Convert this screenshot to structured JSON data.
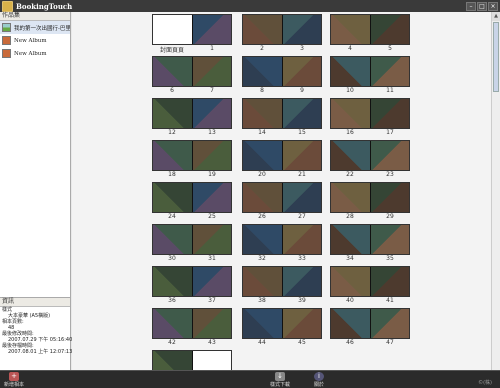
{
  "window": {
    "title": "BookingTouch"
  },
  "sidebar": {
    "label": "作品集",
    "albums": [
      {
        "label": "我的第一次出國行-巴里島",
        "icon": "photo-album-icon"
      },
      {
        "label": "New Album",
        "icon": "book-icon"
      },
      {
        "label": "New Album",
        "icon": "book-icon"
      }
    ]
  },
  "info": {
    "label": "資訊",
    "rows": [
      {
        "text": "樣式",
        "ind": false
      },
      {
        "text": "大本豪華 (A5橫版)",
        "ind": true
      },
      {
        "text": "相本頁數:",
        "ind": false
      },
      {
        "text": "48",
        "ind": true
      },
      {
        "text": "最後修改時間:",
        "ind": false
      },
      {
        "text": "2007.07.29 下午 05:16:40",
        "ind": true
      },
      {
        "text": "最後存檔時間:",
        "ind": false
      },
      {
        "text": "2007.08.01 上午 12:07:13",
        "ind": true
      }
    ]
  },
  "spreads": [
    {
      "labels": [
        "封面頁頁",
        "1"
      ],
      "left_blank": true
    },
    {
      "labels": [
        "2",
        "3"
      ]
    },
    {
      "labels": [
        "4",
        "5"
      ]
    },
    {
      "labels": [
        "6",
        "7"
      ]
    },
    {
      "labels": [
        "8",
        "9"
      ]
    },
    {
      "labels": [
        "10",
        "11"
      ]
    },
    {
      "labels": [
        "12",
        "13"
      ]
    },
    {
      "labels": [
        "14",
        "15"
      ]
    },
    {
      "labels": [
        "16",
        "17"
      ]
    },
    {
      "labels": [
        "18",
        "19"
      ]
    },
    {
      "labels": [
        "20",
        "21"
      ]
    },
    {
      "labels": [
        "22",
        "23"
      ]
    },
    {
      "labels": [
        "24",
        "25"
      ]
    },
    {
      "labels": [
        "26",
        "27"
      ]
    },
    {
      "labels": [
        "28",
        "29"
      ]
    },
    {
      "labels": [
        "30",
        "31"
      ]
    },
    {
      "labels": [
        "32",
        "33"
      ]
    },
    {
      "labels": [
        "34",
        "35"
      ]
    },
    {
      "labels": [
        "36",
        "37"
      ]
    },
    {
      "labels": [
        "38",
        "39"
      ]
    },
    {
      "labels": [
        "40",
        "41"
      ]
    },
    {
      "labels": [
        "42",
        "43"
      ]
    },
    {
      "labels": [
        "44",
        "45"
      ]
    },
    {
      "labels": [
        "46",
        "47"
      ]
    },
    {
      "labels": [
        "",
        ""
      ],
      "right_blank": true
    }
  ],
  "bottom": {
    "new_album_label": "新增相本",
    "download_label": "樣式下載",
    "about_label": "關於",
    "watermark": "©(株)"
  }
}
